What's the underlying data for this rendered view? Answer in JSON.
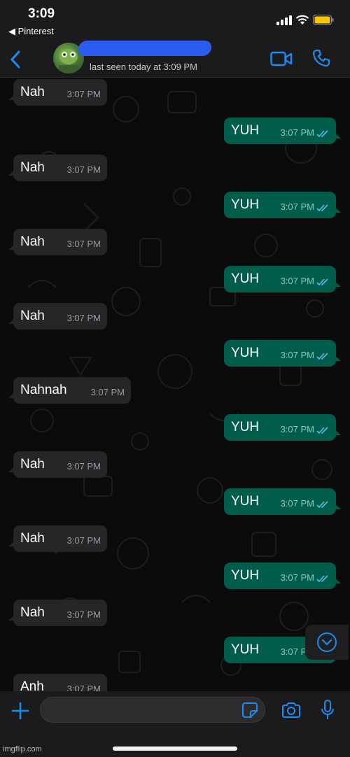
{
  "status_bar": {
    "time": "3:09",
    "back_app": "◀ Pinterest"
  },
  "header": {
    "last_seen": "last seen today at 3:09 PM",
    "colors": {
      "accent": "#1c8cf0",
      "redaction": "#2c5cf0"
    }
  },
  "messages": [
    {
      "dir": "in",
      "text": "Nah",
      "time": "3:07 PM"
    },
    {
      "dir": "out",
      "text": "YUH",
      "time": "3:07 PM",
      "status": "read"
    },
    {
      "dir": "in",
      "text": "Nah",
      "time": "3:07 PM"
    },
    {
      "dir": "out",
      "text": "YUH",
      "time": "3:07 PM",
      "status": "read"
    },
    {
      "dir": "in",
      "text": "Nah",
      "time": "3:07 PM"
    },
    {
      "dir": "out",
      "text": "YUH",
      "time": "3:07 PM",
      "status": "read"
    },
    {
      "dir": "in",
      "text": "Nah",
      "time": "3:07 PM"
    },
    {
      "dir": "out",
      "text": "YUH",
      "time": "3:07 PM",
      "status": "read"
    },
    {
      "dir": "in",
      "text": "Nahnah",
      "time": "3:07 PM"
    },
    {
      "dir": "out",
      "text": "YUH",
      "time": "3:07 PM",
      "status": "read"
    },
    {
      "dir": "in",
      "text": "Nah",
      "time": "3:07 PM"
    },
    {
      "dir": "out",
      "text": "YUH",
      "time": "3:07 PM",
      "status": "read"
    },
    {
      "dir": "in",
      "text": "Nah",
      "time": "3:07 PM"
    },
    {
      "dir": "out",
      "text": "YUH",
      "time": "3:07 PM",
      "status": "read"
    },
    {
      "dir": "in",
      "text": "Nah",
      "time": "3:07 PM"
    },
    {
      "dir": "out",
      "text": "YUH",
      "time": "3:07 PM",
      "status": "read"
    },
    {
      "dir": "in",
      "text": "Anh",
      "time": "3:07 PM"
    }
  ],
  "icons": {
    "back": "chevron-left-icon",
    "video": "video-call-icon",
    "phone": "phone-call-icon",
    "plus": "plus-icon",
    "sticker": "sticker-icon",
    "camera": "camera-icon",
    "mic": "microphone-icon",
    "scroll": "chevron-down-circle-icon",
    "read_receipt": "double-check-icon"
  },
  "colors": {
    "incoming_bubble": "#262628",
    "outgoing_bubble": "#005c4b",
    "read_tick": "#53bdeb"
  },
  "watermark": "imgflip.com"
}
